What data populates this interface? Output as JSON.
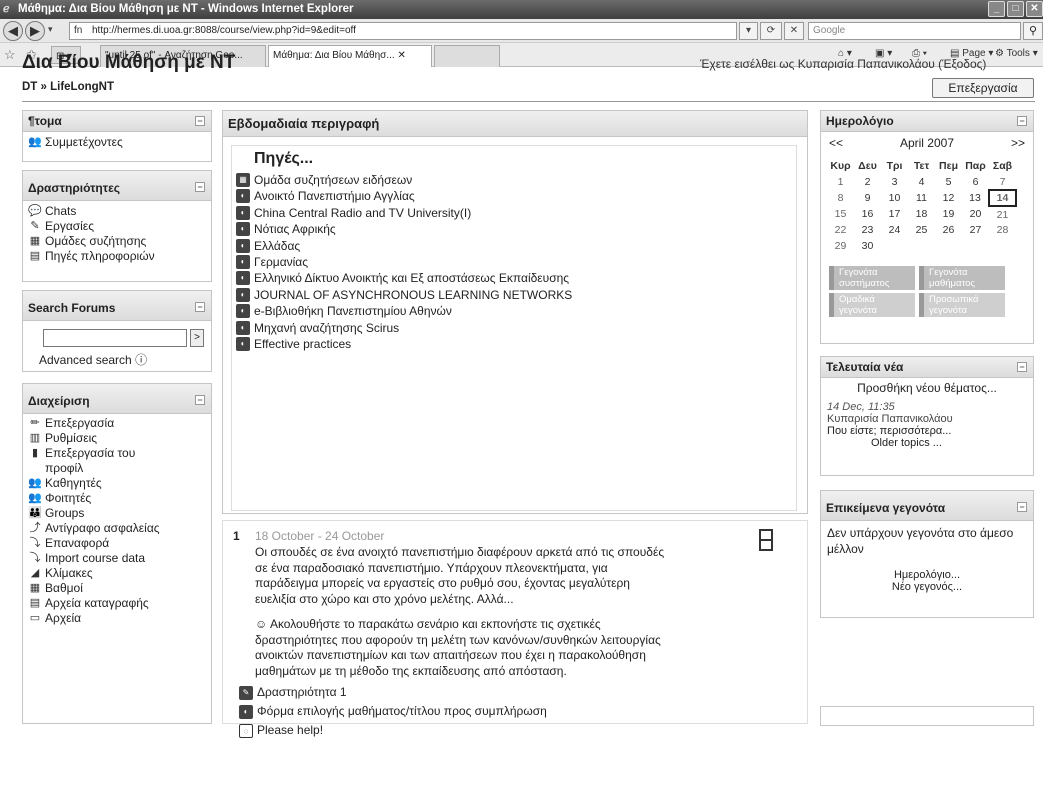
{
  "browser": {
    "window_title": "Μάθημα: Δια Βίου Μάθηση με NT - Windows Internet Explorer",
    "url": "http://hermes.di.uoa.gr:8088/course/view.php?id=9&edit=off",
    "search_placeholder": "Google",
    "tabs": [
      {
        "label": "\"until 25 of\" - Αναζήτηση Goo..."
      },
      {
        "label": "Μάθημα: Δια Βίου Μάθησ..."
      }
    ],
    "commands": {
      "page": "Page",
      "tools": "Tools"
    }
  },
  "header": {
    "site_title": "Δια Βίου Μάθηση με NT",
    "login_info": "Έχετε εισέλθει ως Κυπαρισία Παπανικολάου (Έξοδος)",
    "breadcrumb": "DT » LifeLongNT",
    "edit_button": "Επεξεργασία"
  },
  "left": {
    "people": {
      "title": "¶τομα",
      "items": [
        {
          "label": "Συμμετέχοντες",
          "icon": "people-icon"
        }
      ]
    },
    "activities": {
      "title": "Δραστηριότητες",
      "items": [
        {
          "label": "Chats",
          "icon": "chat-icon"
        },
        {
          "label": "Εργασίες",
          "icon": "assignment-icon"
        },
        {
          "label": "Ομάδες συζήτησης",
          "icon": "forum-icon"
        },
        {
          "label": "Πηγές πληροφοριών",
          "icon": "resource-icon"
        }
      ]
    },
    "search_forums": {
      "title": "Search Forums",
      "go": ">",
      "advanced": "Advanced search"
    },
    "admin": {
      "title": "Διαχείριση",
      "items": [
        {
          "label": "Επεξεργασία",
          "icon": "edit-icon"
        },
        {
          "label": "Ρυθμίσεις",
          "icon": "settings-icon"
        },
        {
          "label": "Επεξεργασία του",
          "icon": "profile-edit-icon"
        },
        {
          "label": "προφίλ",
          "icon": ""
        },
        {
          "label": "Καθηγητές",
          "icon": "teachers-icon"
        },
        {
          "label": "Φοιτητές",
          "icon": "students-icon"
        },
        {
          "label": "Groups",
          "icon": "groups-icon"
        },
        {
          "label": "Αντίγραφο ασφαλείας",
          "icon": "backup-icon"
        },
        {
          "label": "Επαναφορά",
          "icon": "restore-icon"
        },
        {
          "label": "Import course data",
          "icon": "import-icon"
        },
        {
          "label": "Κλίμακες",
          "icon": "scales-icon"
        },
        {
          "label": "Βαθμοί",
          "icon": "grades-icon"
        },
        {
          "label": "Αρχεία καταγραφής",
          "icon": "logs-icon"
        },
        {
          "label": "Αρχεία",
          "icon": "files-icon"
        }
      ]
    }
  },
  "center": {
    "title": "Εβδομαδιαία περιγραφή",
    "sources": {
      "heading": "Πηγές...",
      "items": [
        {
          "label": "Ομάδα συζητήσεων ειδήσεων",
          "icon": "forum-icon"
        },
        {
          "label": "Ανοικτό Πανεπιστήμιο Αγγλίας",
          "icon": "link-icon"
        },
        {
          "label": "China Central Radio and TV University(I)",
          "icon": "link-icon"
        },
        {
          "label": "Νότιας Αφρικής",
          "icon": "link-icon"
        },
        {
          "label": "Ελλάδας",
          "icon": "link-icon"
        },
        {
          "label": "Γερμανίας",
          "icon": "link-icon"
        },
        {
          "label": "Ελληνικό Δίκτυο Ανοικτής και Εξ αποστάσεως Εκπαίδευσης",
          "icon": "link-icon"
        },
        {
          "label": "JOURNAL OF ASYNCHRONOUS LEARNING NETWORKS",
          "icon": "link-icon"
        },
        {
          "label": "e-Βιβλιοθήκη Πανεπιστημίου Αθηνών",
          "icon": "link-icon"
        },
        {
          "label": "Μηχανή αναζήτησης Scirus",
          "icon": "link-icon"
        },
        {
          "label": "Effective practices",
          "icon": "link-icon"
        }
      ]
    },
    "week1": {
      "number": "1",
      "dates": "18 October - 24 October",
      "summary_lines": [
        "Οι σπουδές σε ένα ανοιχτό πανεπιστήμιο διαφέρουν αρκετά από τις σπουδές",
        "σε ένα παραδοσιακό πανεπιστήμιο. Υπάρχουν πλεονεκτήματα, για",
        "παράδειγμα μπορείς να εργαστείς στο ρυθμό σου, έχοντας μεγαλύτερη",
        "ευελιξία στο χώρο και στο χρόνο μελέτης. Αλλά..."
      ],
      "scenario_lines": [
        "Ακολουθήστε το παρακάτω σενάριο και εκπονήστε τις σχετικές",
        "δραστηριότητες που αφορούν τη μελέτη των κανόνων/συνθηκών λειτουργίας",
        "ανοικτών πανεπιστημίων και των απαιτήσεων που έχει η παρακολούθηση",
        "μαθημάτων με τη μέθοδο της εκπαίδευσης από απόσταση."
      ],
      "activities": [
        {
          "label": "Δραστηριότητα 1",
          "icon": "assignment-icon"
        },
        {
          "label": "Φόρμα επιλογής μαθήματος/τίτλου προς συμπλήρωση",
          "icon": "form-icon"
        },
        {
          "label": "Please help!",
          "icon": "chat-icon"
        }
      ]
    }
  },
  "right": {
    "calendar": {
      "title": "Ημερολόγιο",
      "prev": "<<",
      "next": ">>",
      "month": "April 2007",
      "weekdays": [
        "Κυρ",
        "Δευ",
        "Τρι",
        "Τετ",
        "Πεμ",
        "Παρ",
        "Σαβ"
      ],
      "weeks": [
        [
          "1",
          "2",
          "3",
          "4",
          "5",
          "6",
          "7"
        ],
        [
          "8",
          "9",
          "10",
          "11",
          "12",
          "13",
          "14"
        ],
        [
          "15",
          "16",
          "17",
          "18",
          "19",
          "20",
          "21"
        ],
        [
          "22",
          "23",
          "24",
          "25",
          "26",
          "27",
          "28"
        ],
        [
          "29",
          "30",
          "",
          "",
          "",
          "",
          ""
        ]
      ],
      "today": "14",
      "legend": [
        "Γεγονότα συστήματος",
        "Γεγονότα μαθήματος",
        "Ομαδικά γεγονότα",
        "Προσωπικά γεγονότα"
      ]
    },
    "news": {
      "title": "Τελευταία νέα",
      "add_topic": "Προσθήκη νέου θέματος...",
      "date": "14 Dec, 11:35",
      "author": "Κυπαρισία Παπανικολάου",
      "headline": "Που είστε; περισσότερα...",
      "older": "Older topics ..."
    },
    "upcoming": {
      "title": "Επικείμενα γεγονότα",
      "empty": "Δεν υπάρχουν γεγονότα στο άμεσο μέλλον",
      "calendar_link": "Ημερολόγιο...",
      "new_event": "Νέο γεγονός..."
    }
  }
}
